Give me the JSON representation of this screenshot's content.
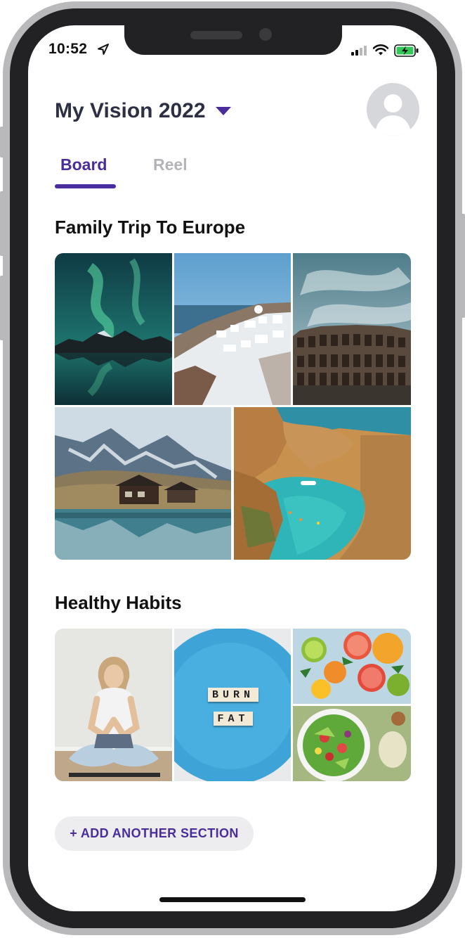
{
  "status_bar": {
    "time": "10:52"
  },
  "header": {
    "title": "My Vision 2022"
  },
  "tabs": [
    {
      "label": "Board",
      "active": true
    },
    {
      "label": "Reel",
      "active": false
    }
  ],
  "sections": [
    {
      "title": "Family Trip To Europe",
      "photos": [
        "northern-lights",
        "santorini",
        "colosseum",
        "alpine-lake-chalet",
        "coastal-cove"
      ]
    },
    {
      "title": "Healthy Habits",
      "photos": [
        "yoga",
        "burn-fat-plate",
        "citrus-fruits",
        "salad-bowl"
      ],
      "tiles": {
        "tile1": {
          "text": "BURN"
        },
        "tile2": {
          "text": "FAT"
        }
      }
    }
  ],
  "actions": {
    "add_section": "+ ADD ANOTHER SECTION"
  },
  "colors": {
    "accent": "#4a2d9c",
    "title": "#2d2f45",
    "tab_inactive": "#b4b4b8",
    "button_bg": "#ededf0"
  }
}
